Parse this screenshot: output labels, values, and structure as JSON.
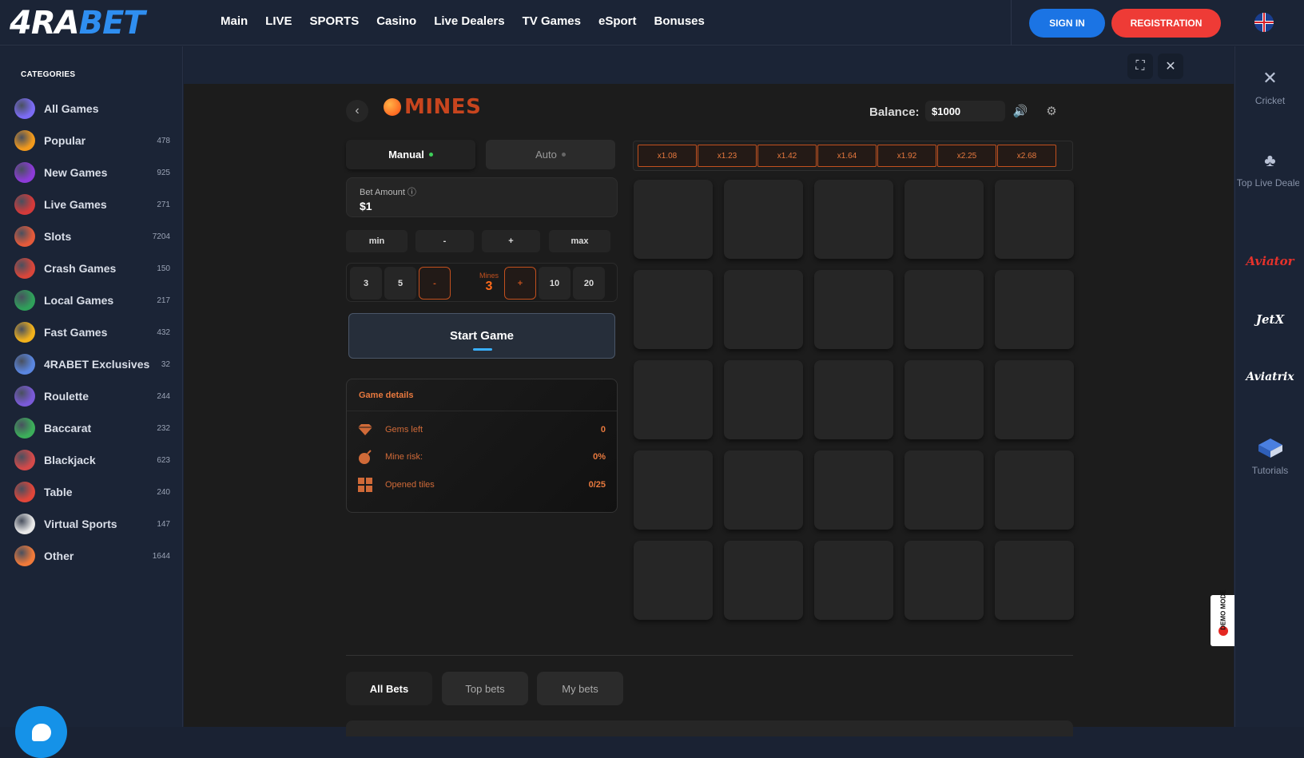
{
  "header": {
    "logo_left": "4RA",
    "logo_right": "BET",
    "nav": [
      "Main",
      "LIVE",
      "SPORTS",
      "Casino",
      "Live Dealers",
      "TV Games",
      "eSport",
      "Bonuses"
    ],
    "signin": "SIGN IN",
    "registration": "REGISTRATION"
  },
  "sidebar": {
    "title": "CATEGORIES",
    "items": [
      {
        "label": "All Games",
        "count": "",
        "color": "#7b6cf5"
      },
      {
        "label": "Popular",
        "count": "478",
        "color": "#f39a1c"
      },
      {
        "label": "New Games",
        "count": "925",
        "color": "#8c3bd8"
      },
      {
        "label": "Live Games",
        "count": "271",
        "color": "#d43a3a"
      },
      {
        "label": "Slots",
        "count": "7204",
        "color": "#e45a3a"
      },
      {
        "label": "Crash Games",
        "count": "150",
        "color": "#d9463a"
      },
      {
        "label": "Local Games",
        "count": "217",
        "color": "#2fa05a"
      },
      {
        "label": "Fast Games",
        "count": "432",
        "color": "#f2b21c"
      },
      {
        "label": "4RABET Exclusives",
        "count": "32",
        "color": "#5a86e0"
      },
      {
        "label": "Roulette",
        "count": "244",
        "color": "#7a5ad8"
      },
      {
        "label": "Baccarat",
        "count": "232",
        "color": "#3cae5a"
      },
      {
        "label": "Blackjack",
        "count": "623",
        "color": "#d44a4a"
      },
      {
        "label": "Table",
        "count": "240",
        "color": "#e0463a"
      },
      {
        "label": "Virtual Sports",
        "count": "147",
        "color": "#e8e8e8"
      },
      {
        "label": "Other",
        "count": "1644",
        "color": "#f07a3a"
      }
    ]
  },
  "game": {
    "title": "MINES",
    "balance_label": "Balance:",
    "balance_value": "$1000",
    "mode_manual": "Manual",
    "mode_auto": "Auto",
    "bet_label": "Bet Amount ⓘ",
    "bet_value": "$1",
    "bet_buttons": [
      "min",
      "-",
      "+",
      "max"
    ],
    "mines_presets": [
      "3",
      "5",
      "10",
      "20"
    ],
    "mines_minus": "-",
    "mines_plus": "+",
    "mines_label": "Mines",
    "mines_value": "3",
    "start": "Start Game",
    "details_title": "Game details",
    "details": [
      {
        "label": "Gems left",
        "value": "0",
        "icon": "diamond-icon"
      },
      {
        "label": "Mine risk:",
        "value": "0%",
        "icon": "bomb-icon"
      },
      {
        "label": "Opened tiles",
        "value": "0/25",
        "icon": "grid-icon"
      }
    ],
    "multipliers": [
      "x1.08",
      "x1.23",
      "x1.42",
      "x1.64",
      "x1.92",
      "x2.25",
      "x2.68"
    ],
    "tabs": [
      "All Bets",
      "Top bets",
      "My bets"
    ],
    "demo": "DEMO MODE"
  },
  "rightbar": {
    "items": [
      "Cricket",
      "Top Live Dealer",
      "Aviator",
      "JetX",
      "Aviatrix",
      "Tutorials"
    ]
  },
  "colors": {
    "accent": "#e8793e",
    "signin": "#1b74e4",
    "registration": "#ee3b36"
  }
}
